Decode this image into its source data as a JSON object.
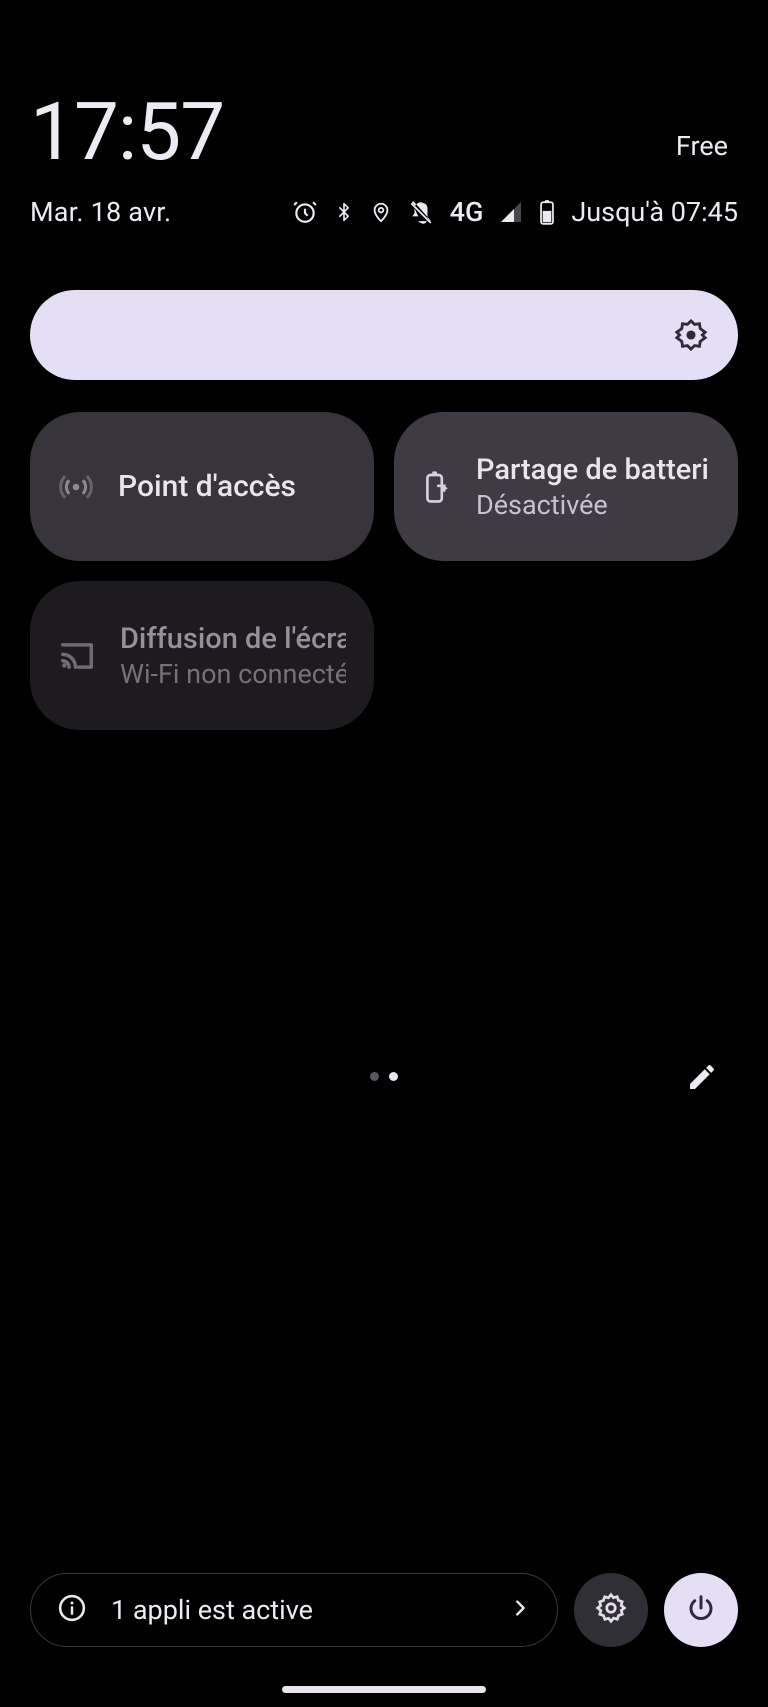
{
  "header": {
    "time": "17:57",
    "carrier": "Free",
    "date": "Mar. 18 avr.",
    "network_type": "4G",
    "battery_until": "Jusqu'à 07:45"
  },
  "tiles": [
    {
      "id": "hotspot",
      "title": "Point d'accès",
      "subtitle": ""
    },
    {
      "id": "batteryshare",
      "title": "Partage de batterie",
      "subtitle": "Désactivée"
    },
    {
      "id": "cast",
      "title": "Diffusion de l'écran",
      "subtitle": "Wi-Fi non connecté"
    }
  ],
  "footer": {
    "active_apps": "1 appli est active"
  }
}
